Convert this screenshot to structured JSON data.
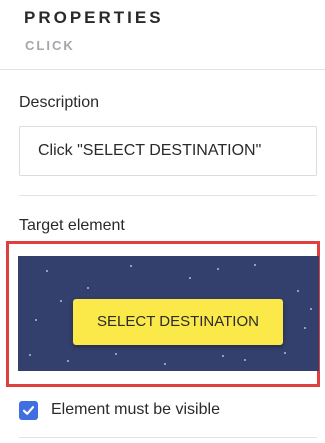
{
  "header": {
    "title": "PROPERTIES",
    "subtitle": "CLICK"
  },
  "description": {
    "label": "Description",
    "value": "Click \"SELECT DESTINATION\""
  },
  "target": {
    "label": "Target element",
    "button_text": "SELECT DESTINATION"
  },
  "visibility": {
    "label": "Element must be visible",
    "checked": true
  },
  "colors": {
    "highlight_border": "#e0403d",
    "preview_background": "#33406d",
    "button_yellow": "#fbe94a",
    "checkbox_blue": "#3f6fe0"
  },
  "icons": {
    "checkbox": "checkmark-icon"
  }
}
